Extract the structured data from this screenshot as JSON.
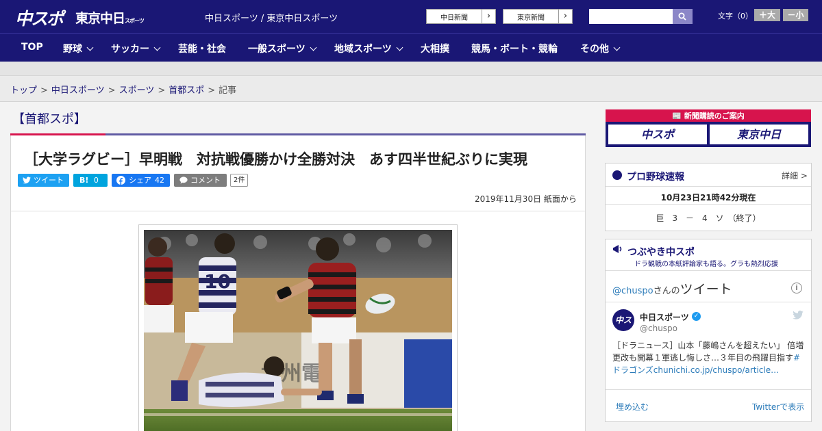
{
  "header": {
    "logo_main": "中スポ",
    "logo_tokyo": "東京中日",
    "logo_tokyo_small": "スポーツ",
    "site_names": "中日スポーツ / 東京中日スポーツ",
    "ext_links": [
      {
        "label": "中日新聞"
      },
      {
        "label": "東京新聞"
      }
    ],
    "search_placeholder": "",
    "font_size_label": "文字（0）",
    "font_increase": "＋大",
    "font_decrease": "－小"
  },
  "nav": {
    "items": [
      {
        "label": "TOP"
      },
      {
        "label": "野球"
      },
      {
        "label": "サッカー"
      },
      {
        "label": "芸能・社会"
      },
      {
        "label": "一般スポーツ"
      },
      {
        "label": "地域スポーツ"
      },
      {
        "label": "大相撲"
      },
      {
        "label": "競馬・ボート・競輪"
      },
      {
        "label": "その他"
      }
    ]
  },
  "breadcrumb": {
    "items": [
      "トップ",
      "中日スポーツ",
      "スポーツ",
      "首都スポ"
    ],
    "current": "記事"
  },
  "article": {
    "section": "【首都スポ】",
    "headline": "［大学ラグビー］早明戦　対抗戦優勝かけ全勝対決　あす四半世紀ぶりに実現",
    "share": {
      "tweet": "ツイート",
      "hatena_icon": "B!",
      "hatena_count": "0",
      "facebook": "シェア",
      "facebook_count": "42",
      "comment": "コメント",
      "comment_count": "2件"
    },
    "dateline": "2019年11月30日 紙面から",
    "photo_jersey_number": "10"
  },
  "sidebar": {
    "subscription": {
      "title": "新聞購読のご案内",
      "btn1": "中スポ",
      "btn2": "東京中日"
    },
    "baseball": {
      "title": "プロ野球速報",
      "detail_link": "詳細 >",
      "as_of": "10月23日21時42分現在",
      "score": "巨　3　－　4　ソ　（終了）"
    },
    "tweets": {
      "title": "つぶやき中スポ",
      "subtitle": "ドラ観戦の本紙評論家も語る。グラも熱烈応援",
      "handle_prefix": "@chuspo",
      "handle_suffix": "さんの",
      "heading": "ツイート",
      "account_name": "中日スポーツ",
      "account_user": "@chuspo",
      "avatar_text": "中スポ",
      "text": "［ドラニュース］山本「藤嶋さんを超えたい」 倍増更改も開幕１軍逃し悔しさ…３年目の飛躍目指す",
      "text_link": "#ドラゴンズchunichi.co.jp/chuspo/article…",
      "embed_label": "埋め込む",
      "view_on_twitter": "Twitterで表示"
    }
  },
  "colors": {
    "brand_navy": "#1a1775",
    "accent_red": "#d7144d",
    "twitter": "#1da1f2",
    "hatena": "#00a4de",
    "facebook": "#1877f2"
  }
}
